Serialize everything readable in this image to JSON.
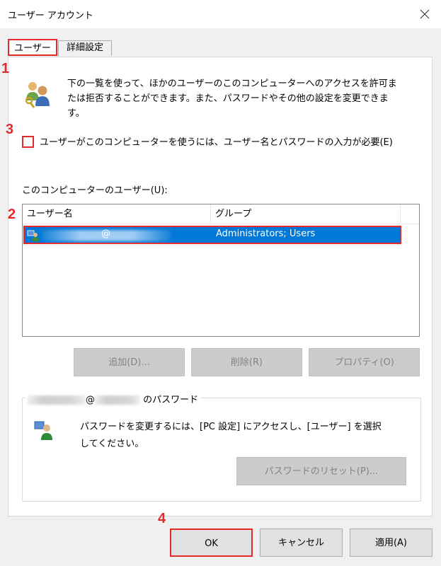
{
  "window": {
    "title": "ユーザー アカウント"
  },
  "tabs": [
    {
      "label": "ユーザー",
      "selected": true
    },
    {
      "label": "詳細設定",
      "selected": false
    }
  ],
  "markers": [
    "1",
    "2",
    "3",
    "4"
  ],
  "description": {
    "line1": "下の一覧を使って、ほかのユーザーのこのコンピューターへのアクセスを許可ま",
    "line2": "たは拒否することができます。また、パスワードやその他の設定を変更できま",
    "line3": "す。"
  },
  "require_password": {
    "label": "ユーザーがこのコンピューターを使うには、ユーザー名とパスワードの入力が必要(E)",
    "checked": false
  },
  "user_list": {
    "label": "このコンピューターのユーザー(U):",
    "columns": [
      "ユーザー名",
      "グループ"
    ],
    "rows": [
      {
        "user_name": "@",
        "group": "Administrators; Users",
        "selected": true
      }
    ]
  },
  "list_buttons": {
    "add": "追加(D)...",
    "remove": "削除(R)",
    "properties": "プロパティ(O)"
  },
  "password_group": {
    "at": "@",
    "suffix": "のパスワード",
    "text_line1": "パスワードを変更するには、[PC 設定] にアクセスし、[ユーザー] を選択",
    "text_line2": "してください。",
    "reset_button": "パスワードのリセット(P)..."
  },
  "footer": {
    "ok": "OK",
    "cancel": "キャンセル",
    "apply": "適用(A)"
  },
  "colors": {
    "highlight": "#e32a2a",
    "selection": "#0078d7"
  }
}
